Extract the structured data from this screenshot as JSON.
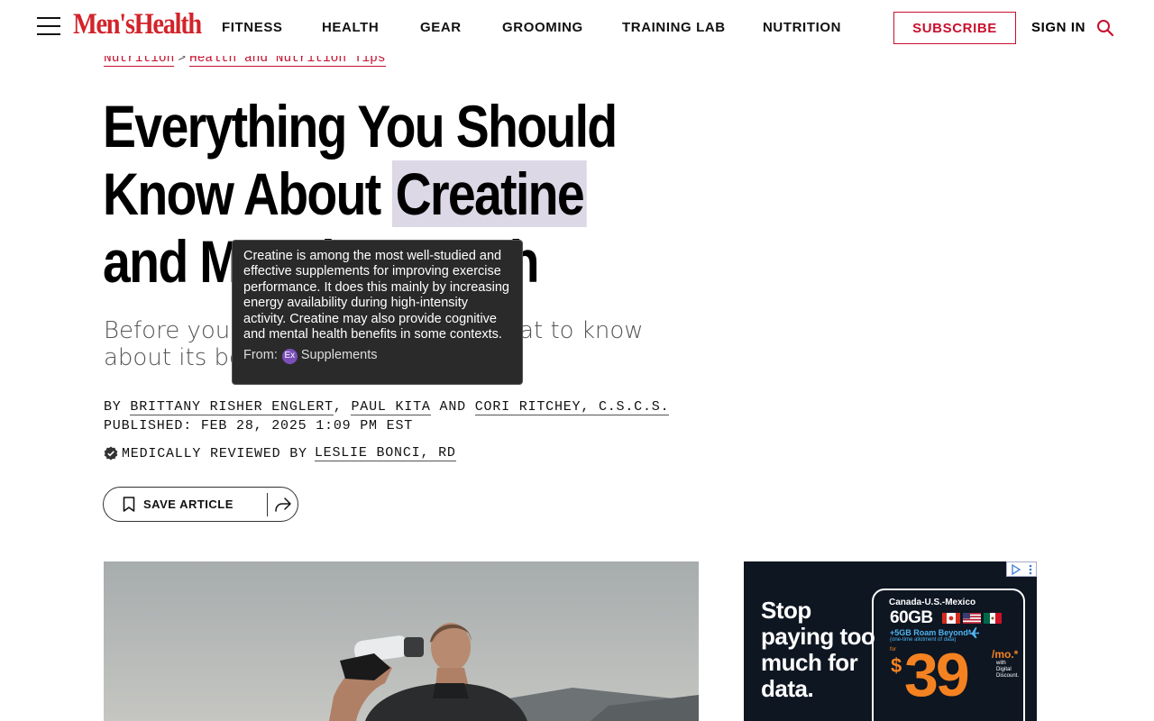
{
  "header": {
    "logo": "Men'sHealth",
    "nav": [
      "FITNESS",
      "HEALTH",
      "GEAR",
      "GROOMING",
      "TRAINING LAB",
      "NUTRITION"
    ],
    "subscribe_label": "SUBSCRIBE",
    "signin_label": "SIGN IN"
  },
  "breadcrumb": {
    "items": [
      "Nutrition",
      "Health and Nutrition Tips"
    ],
    "separator": ">"
  },
  "article": {
    "headline_part1": "Everything You Should Know About",
    "headline_highlight": "Creatine",
    "headline_part2": "and Muscle Growth",
    "dek": "Before you take creatine, here's what to know about its benefits—and",
    "byline_prefix": "BY",
    "authors": [
      "BRITTANY RISHER ENGLERT",
      "PAUL KITA",
      "CORI RITCHEY, C.S.C.S."
    ],
    "byline_sep1": ",",
    "byline_and": "AND",
    "published": "PUBLISHED: FEB 28, 2025 1:09 PM EST",
    "reviewed_prefix": "MEDICALLY REVIEWED BY",
    "reviewer": "LESLIE BONCI, RD",
    "save_label": "SAVE ARTICLE"
  },
  "tooltip": {
    "text": "Creatine is among the most well-studied and effective supplements for improving exercise performance. It does this mainly by increasing energy availability during high-intensity activity. Creatine may also provide cognitive and mental health benefits in some contexts.",
    "from_label": "From:",
    "badge": "Ex",
    "source": "Supplements"
  },
  "ad": {
    "headline": "Stop paying too much for data.",
    "route": "Canada-U.S.-Mexico",
    "data": "60GB",
    "roam": "+5GB Roam Beyond*",
    "allotment": "(one-time allotment of data)",
    "for_label": "for",
    "dollar": "$",
    "price": "39",
    "per_month": "/mo.*",
    "fine_print": "with Digital Discount."
  },
  "colors": {
    "brand_red": "#d2232a",
    "highlight": "#ddd8e6",
    "tooltip_bg": "#2a2a2a",
    "ad_orange": "#f58220"
  }
}
